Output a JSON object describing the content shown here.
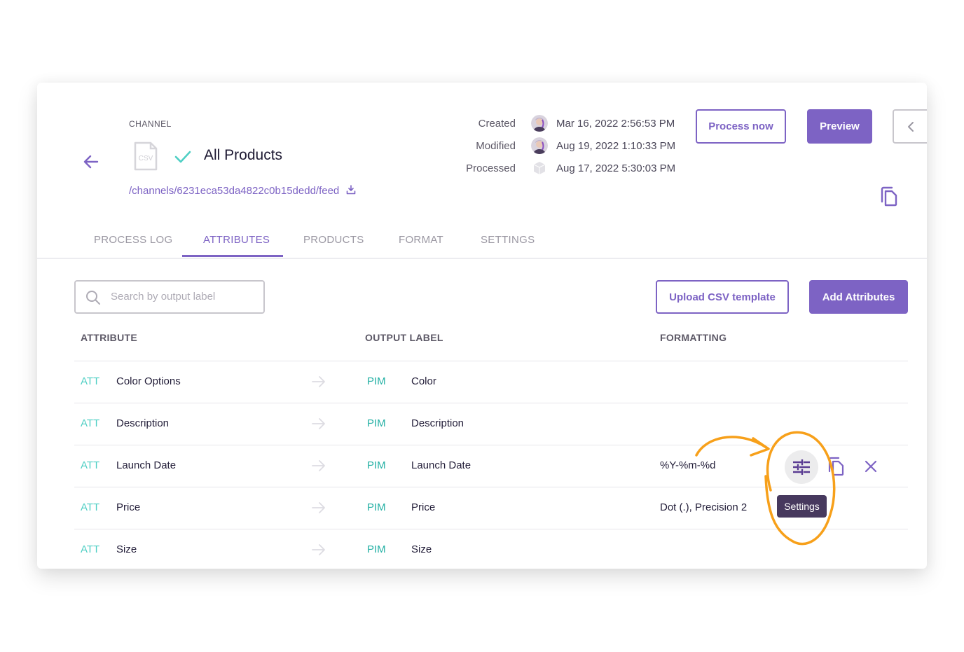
{
  "header": {
    "section_label": "CHANNEL",
    "file_type": "CSV",
    "title": "All Products",
    "feed_link": "/channels/6231eca53da4822c0b15dedd/feed",
    "status": "success"
  },
  "meta": [
    {
      "label": "Created",
      "value": "Mar 16, 2022 2:56:53 PM",
      "actor": "user-avatar"
    },
    {
      "label": "Modified",
      "value": "Aug 19, 2022 1:10:33 PM",
      "actor": "user-avatar"
    },
    {
      "label": "Processed",
      "value": "Aug 17, 2022 5:30:03 PM",
      "actor": "system-cube"
    }
  ],
  "actions": {
    "process_now": "Process now",
    "preview": "Preview"
  },
  "tabs": [
    {
      "label": "PROCESS LOG",
      "active": false
    },
    {
      "label": "ATTRIBUTES",
      "active": true
    },
    {
      "label": "PRODUCTS",
      "active": false
    },
    {
      "label": "FORMAT",
      "active": false
    },
    {
      "label": "SETTINGS",
      "active": false
    }
  ],
  "toolbar": {
    "search_placeholder": "Search by output label",
    "search_value": "",
    "upload_csv": "Upload CSV template",
    "add_attributes": "Add Attributes"
  },
  "table": {
    "columns": [
      "ATTRIBUTE",
      "OUTPUT LABEL",
      "FORMATTING"
    ],
    "rows": [
      {
        "source_tag": "ATT",
        "attribute": "Color Options",
        "target_tag": "PIM",
        "output_label": "Color",
        "formatting": ""
      },
      {
        "source_tag": "ATT",
        "attribute": "Description",
        "target_tag": "PIM",
        "output_label": "Description",
        "formatting": ""
      },
      {
        "source_tag": "ATT",
        "attribute": "Launch Date",
        "target_tag": "PIM",
        "output_label": "Launch Date",
        "formatting": "%Y-%m-%d"
      },
      {
        "source_tag": "ATT",
        "attribute": "Price",
        "target_tag": "PIM",
        "output_label": "Price",
        "formatting": "Dot (.), Precision 2"
      },
      {
        "source_tag": "ATT",
        "attribute": "Size",
        "target_tag": "PIM",
        "output_label": "Size",
        "formatting": ""
      }
    ]
  },
  "tooltip": "Settings",
  "colors": {
    "accent": "#7d63c4",
    "att_tag": "#4fcfc4",
    "pim_tag": "#23b0a4",
    "annotation": "#f7a01a",
    "tooltip_bg": "#47395e"
  }
}
